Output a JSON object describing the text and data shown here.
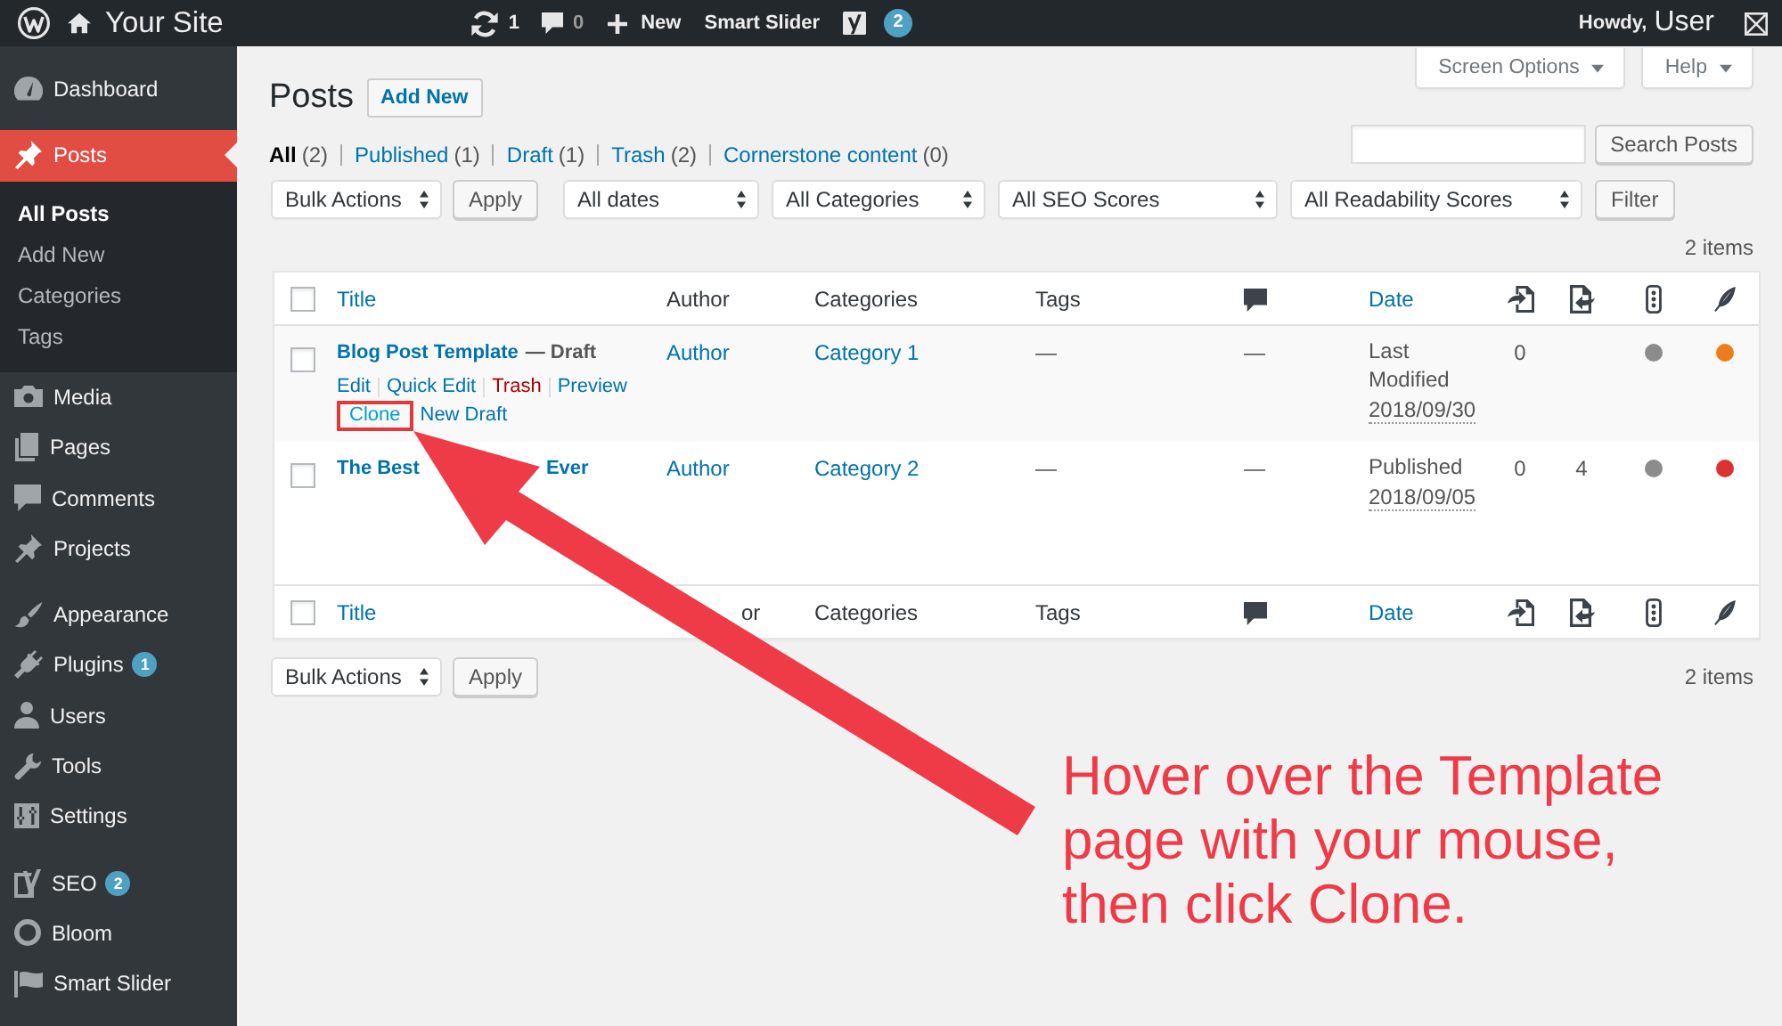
{
  "top_bar": {
    "site_name": "Your Site",
    "updates_count": "1",
    "comments_count": "0",
    "new_label": "New",
    "smart_slider": "Smart Slider",
    "seo_count": "2",
    "greeting": "Howdy,",
    "user_name": "User"
  },
  "sidebar": {
    "groups": [
      {
        "items": [
          {
            "label": "Dashboard",
            "selected": false
          }
        ]
      },
      {
        "items": [
          {
            "label": "Posts",
            "selected": true,
            "children": [
              {
                "label": "All Posts",
                "selected": true
              },
              {
                "label": "Add New",
                "selected": false
              },
              {
                "label": "Categories",
                "selected": false
              },
              {
                "label": "Tags",
                "selected": false
              }
            ]
          },
          {
            "label": "Media",
            "selected": false
          },
          {
            "label": "Pages",
            "selected": false
          },
          {
            "label": "Comments",
            "selected": false
          },
          {
            "label": "Projects",
            "selected": false
          }
        ]
      },
      {
        "items": [
          {
            "label": "Appearance",
            "selected": false
          },
          {
            "label": "Plugins",
            "selected": false,
            "badge": "1"
          },
          {
            "label": "Users",
            "selected": false
          },
          {
            "label": "Tools",
            "selected": false
          },
          {
            "label": "Settings",
            "selected": false
          }
        ]
      },
      {
        "items": [
          {
            "label": "SEO",
            "selected": false,
            "badge": "2"
          },
          {
            "label": "Bloom",
            "selected": false
          },
          {
            "label": "Smart Slider",
            "selected": false
          }
        ]
      }
    ]
  },
  "header": {
    "title": "Posts",
    "add_new": "Add New",
    "screen_options": "Screen Options",
    "help": "Help"
  },
  "views": [
    {
      "label": "All",
      "count": "(2)",
      "selected": true
    },
    {
      "label": "Published",
      "count": "(1)",
      "selected": false
    },
    {
      "label": "Draft",
      "count": "(1)",
      "selected": false
    },
    {
      "label": "Trash",
      "count": "(2)",
      "selected": false
    },
    {
      "label": "Cornerstone content",
      "count": "(0)",
      "selected": false
    }
  ],
  "search": {
    "button": "Search Posts"
  },
  "tablenav_top": {
    "bulk_action": "Bulk Actions",
    "apply": "Apply",
    "selects": [
      "All dates",
      "All Categories",
      "All SEO Scores",
      "All Readability Scores"
    ],
    "filter": "Filter",
    "items_count": "2 items"
  },
  "table": {
    "header_checked": false,
    "columns": [
      {
        "label": "Title",
        "kind": "sortable"
      },
      {
        "label": "Author",
        "kind": "plain"
      },
      {
        "label": "Categories",
        "kind": "plain"
      },
      {
        "label": "Tags",
        "kind": "plain"
      },
      {
        "kind": "icon"
      },
      {
        "label": "Date",
        "kind": "sortable"
      },
      {
        "kind": "icon"
      },
      {
        "kind": "icon"
      },
      {
        "kind": "icon"
      },
      {
        "kind": "icon"
      }
    ],
    "rows": [
      {
        "checked": false,
        "title_parts": [
          "Blog Post Template"
        ],
        "post_state": "— Draft",
        "actions": [
          [
            {
              "label": "Edit",
              "kind": "link",
              "highlighted": false
            },
            {
              "label": "Quick Edit",
              "kind": "link",
              "highlighted": false
            },
            {
              "label": "Trash",
              "kind": "delete",
              "highlighted": false
            },
            {
              "label": "Preview",
              "kind": "link",
              "highlighted": false
            }
          ],
          [
            {
              "label": "Clone",
              "kind": "link",
              "highlighted": true
            },
            {
              "label": "New Draft",
              "kind": "link",
              "highlighted": false
            }
          ]
        ],
        "author": "Author",
        "categories": "Category 1",
        "tags": "—",
        "comments": "—",
        "date_status": "Last Modified",
        "date": "2018/09/30",
        "links": "0",
        "seo_score": {
          "color": "#8c8c8c"
        },
        "readability": {
          "color": "#ee7c1b"
        }
      },
      {
        "checked": false,
        "title_parts": [
          "The Best",
          "Ever"
        ],
        "author": "Author",
        "categories": "Category 2",
        "tags": "—",
        "comments": "—",
        "date_status": "Published",
        "date": "2018/09/05",
        "links": "0",
        "incoming_links": "4",
        "seo_score": {
          "color": "#8c8c8c"
        },
        "readability": {
          "color": "#dc3232"
        }
      }
    ],
    "footer_checked": false,
    "footer_columns": [
      {
        "label": "Title",
        "kind": "sortable"
      },
      {
        "label": "or",
        "kind": "covered"
      },
      {
        "label": "Categories",
        "kind": "plain"
      },
      {
        "label": "Tags",
        "kind": "plain"
      },
      {
        "kind": "icon"
      },
      {
        "label": "Date",
        "kind": "sortable"
      },
      {
        "kind": "icon"
      },
      {
        "kind": "icon"
      },
      {
        "kind": "icon"
      },
      {
        "kind": "icon"
      }
    ]
  },
  "tablenav_bottom": {
    "bulk_action": "Bulk Actions",
    "apply": "Apply",
    "items_count": "2 items"
  },
  "annotation": {
    "text": "Hover over the Template page with your mouse, then click Clone."
  }
}
